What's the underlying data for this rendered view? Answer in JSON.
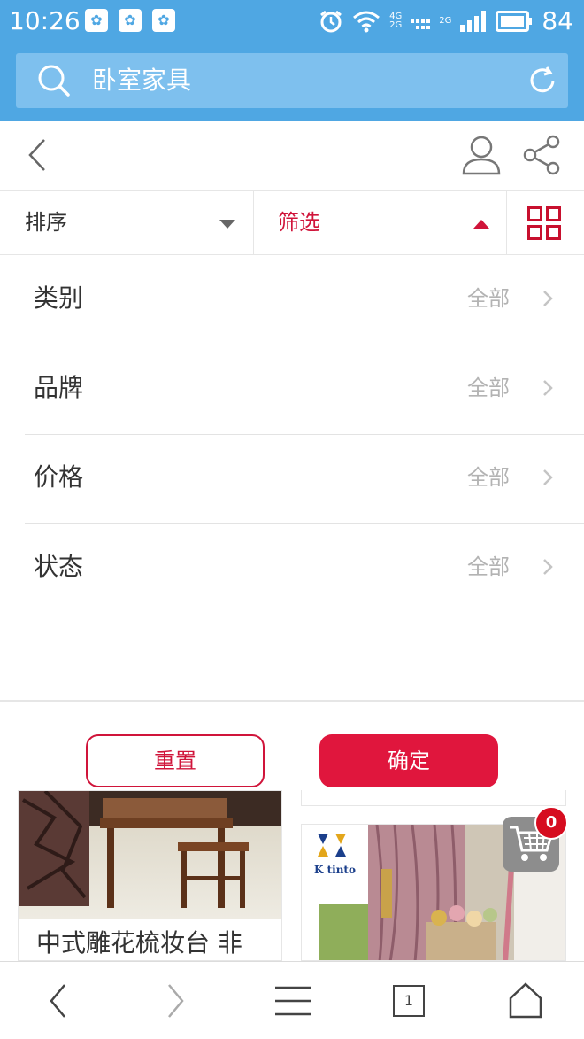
{
  "status_bar": {
    "time": "10:26",
    "battery": "84",
    "network_top": "4G",
    "network_bottom": "2G",
    "network_2g": "2G"
  },
  "search": {
    "query": "卧室家具"
  },
  "tabs": {
    "sort_label": "排序",
    "filter_label": "筛选"
  },
  "filter": {
    "rows": [
      {
        "label": "类别",
        "value": "全部"
      },
      {
        "label": "品牌",
        "value": "全部"
      },
      {
        "label": "价格",
        "value": "全部"
      },
      {
        "label": "状态",
        "value": "全部"
      }
    ],
    "reset_label": "重置",
    "confirm_label": "确定"
  },
  "products": {
    "left_title": "中式雕花梳妆台 非",
    "right_brand_logo": "K tinto"
  },
  "cart": {
    "count": "0"
  },
  "browser": {
    "tab_count": "1"
  },
  "colors": {
    "accent": "#d0143a",
    "status_bar": "#4fa7e3",
    "muted_text": "#b3b3b3"
  },
  "icons": [
    "search-icon",
    "refresh-icon",
    "back-arrow-icon",
    "user-icon",
    "share-icon",
    "dropdown-arrow-icon",
    "grid-view-icon",
    "chevron-right-icon",
    "cart-icon",
    "menu-icon",
    "home-icon",
    "forward-arrow-icon"
  ]
}
